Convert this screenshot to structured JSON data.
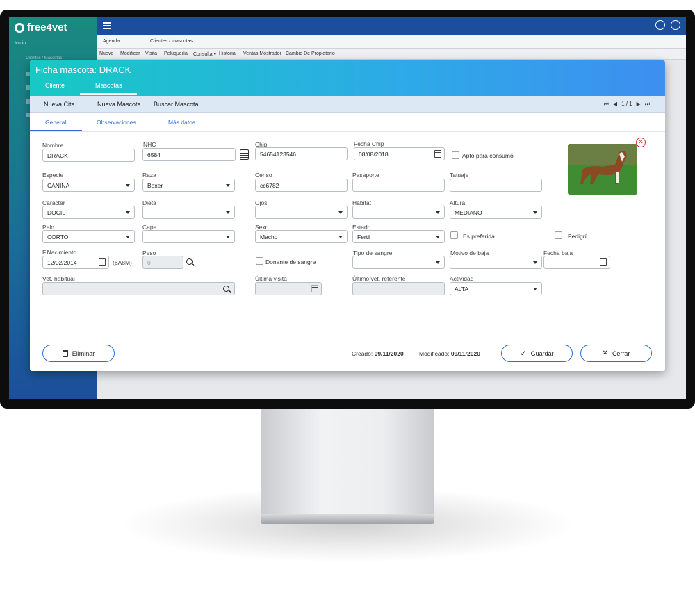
{
  "app": {
    "logo": "free4vet",
    "sidebar_items": [
      "Inicio",
      "Clientes / Mascotas"
    ],
    "tabs": [
      "Agenda",
      "Clientes / mascotas"
    ],
    "menu": [
      "Nuevo",
      "Modificar",
      "Visita",
      "Peluquería",
      "Consulta ▾",
      "Historial",
      "Ventas Mostrador",
      "Cambio De Propietario"
    ]
  },
  "modal": {
    "title": "Ficha mascota: DRACK",
    "tabs": [
      "Cliente",
      "Mascotas"
    ],
    "active_tab": "Mascotas",
    "toolbar": [
      "Nueva Cita",
      "Nueva Mascota",
      "Buscar Mascota"
    ],
    "pager": "1 / 1",
    "subtabs": [
      "General",
      "Observaciones",
      "Más datos"
    ],
    "active_subtab": "General"
  },
  "fields": {
    "nombre": {
      "label": "Nombre",
      "value": "DRACK"
    },
    "nhc": {
      "label": "NHC",
      "value": "6584"
    },
    "chip": {
      "label": "Chip",
      "value": "54654123546"
    },
    "fecha_chip": {
      "label": "Fecha Chip",
      "value": "08/08/2018"
    },
    "apto_consumo": {
      "label": "Apto para consumo"
    },
    "especie": {
      "label": "Especie",
      "value": "CANINA"
    },
    "raza": {
      "label": "Raza",
      "value": "Boxer"
    },
    "censo": {
      "label": "Censo",
      "value": "cc6782"
    },
    "pasaporte": {
      "label": "Pasaporte",
      "value": ""
    },
    "tatuaje": {
      "label": "Tatuaje",
      "value": ""
    },
    "caracter": {
      "label": "Carácter",
      "value": "DOCIL"
    },
    "dieta": {
      "label": "Dieta",
      "value": ""
    },
    "ojos": {
      "label": "Ojos",
      "value": ""
    },
    "habitat": {
      "label": "Hábitat",
      "value": ""
    },
    "altura": {
      "label": "Altura",
      "value": "MEDIANO"
    },
    "pelo": {
      "label": "Pelo",
      "value": "CORTO"
    },
    "capa": {
      "label": "Capa",
      "value": ""
    },
    "sexo": {
      "label": "Sexo",
      "value": "Macho"
    },
    "estado": {
      "label": "Estado",
      "value": "Fertil"
    },
    "es_preferida": {
      "label": "Es preferida"
    },
    "pedigri": {
      "label": "Pedigrí"
    },
    "f_nacimiento": {
      "label": "F.Nacimiento",
      "value": "12/02/2014",
      "age": "(6A8M)"
    },
    "peso": {
      "label": "Peso",
      "value": "0"
    },
    "donante": {
      "label": "Donante de sangre"
    },
    "tipo_sangre": {
      "label": "Tipo de sangre",
      "value": ""
    },
    "motivo_baja": {
      "label": "Motivo de baja",
      "value": ""
    },
    "fecha_baja": {
      "label": "Fecha baja",
      "value": ""
    },
    "vet_habitual": {
      "label": "Vet. habitual",
      "value": ""
    },
    "ultima_visita": {
      "label": "Última visita",
      "value": ""
    },
    "ultimo_vet": {
      "label": "Último vet. referente",
      "value": ""
    },
    "actividad": {
      "label": "Actividad",
      "value": "ALTA"
    }
  },
  "footer": {
    "eliminar": "Eliminar",
    "creado_label": "Creado:",
    "creado_value": "09/11/2020",
    "modificado_label": "Modificado:",
    "modificado_value": "09/11/2020",
    "guardar": "Guardar",
    "cerrar": "Cerrar"
  },
  "colors": {
    "header_start": "#17c9c4",
    "header_end": "#3d8ff0",
    "accent": "#2b6fd6"
  }
}
